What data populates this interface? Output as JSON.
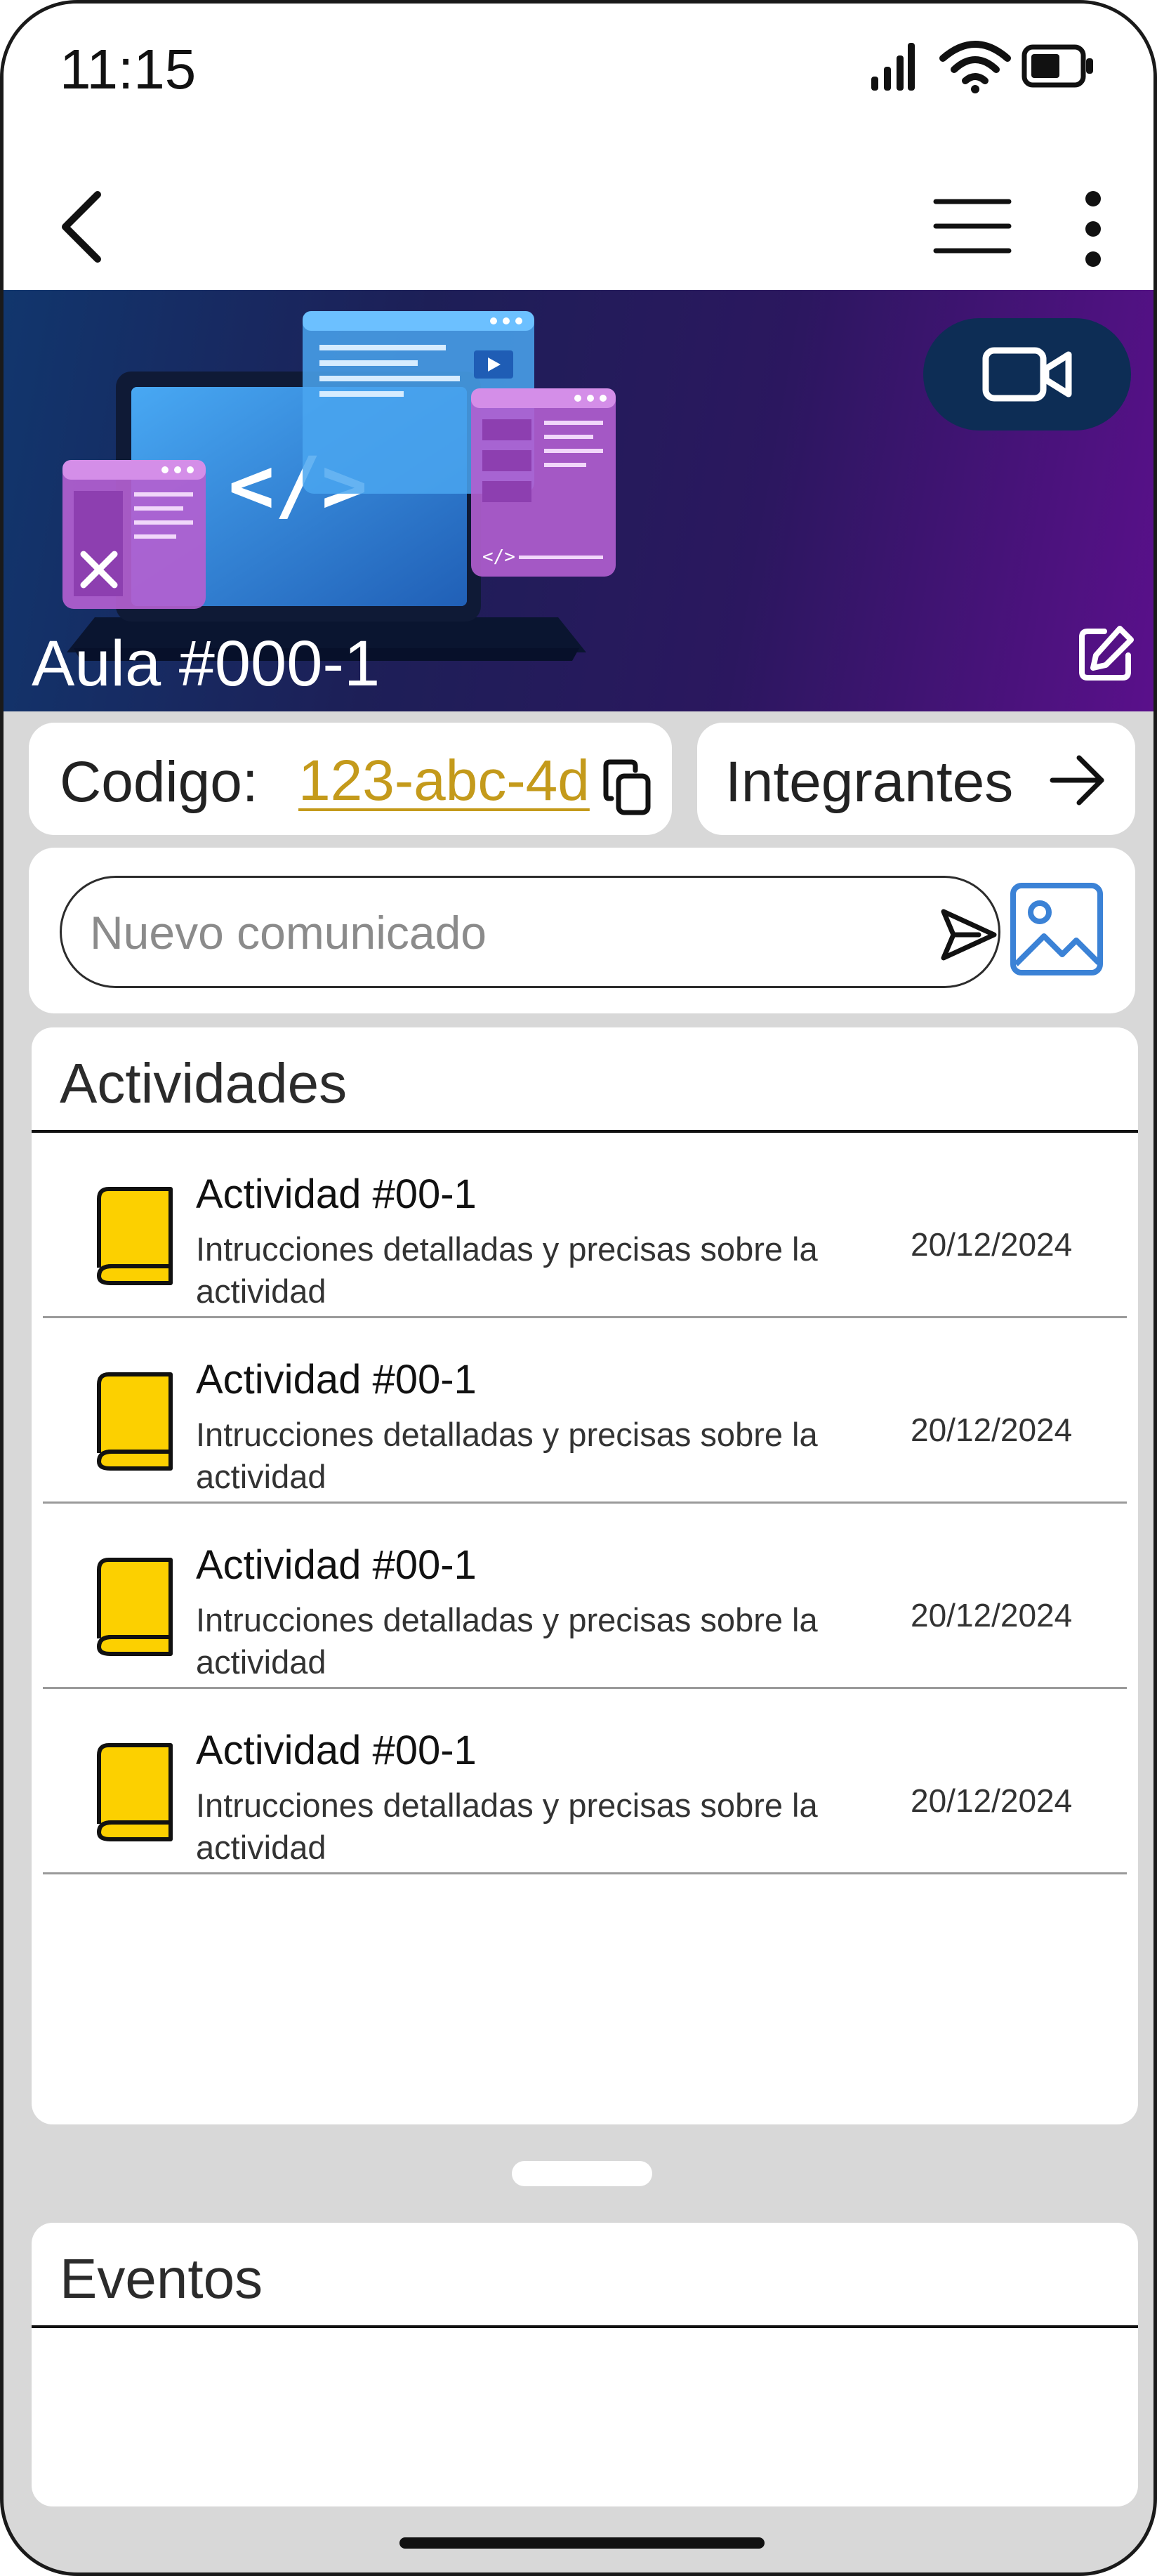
{
  "status_bar": {
    "time": "11:15"
  },
  "classroom": {
    "title": "Aula #000-1",
    "code_label": "Codigo:",
    "code_value": "123-abc-4d",
    "members_label": "Integrantes"
  },
  "announcement": {
    "placeholder": "Nuevo comunicado"
  },
  "activities": {
    "section_title": "Actividades",
    "items": [
      {
        "title": "Actividad #00-1",
        "description": "Intrucciones detalladas y precisas sobre la actividad",
        "date": "20/12/2024"
      },
      {
        "title": "Actividad #00-1",
        "description": "Intrucciones detalladas y precisas sobre la actividad",
        "date": "20/12/2024"
      },
      {
        "title": "Actividad #00-1",
        "description": "Intrucciones detalladas y precisas sobre la actividad",
        "date": "20/12/2024"
      },
      {
        "title": "Actividad #00-1",
        "description": "Intrucciones detalladas y precisas sobre la actividad",
        "date": "20/12/2024"
      }
    ]
  },
  "events": {
    "section_title": "Eventos"
  },
  "icons": {
    "status": [
      "signal-icon",
      "wifi-icon",
      "battery-icon"
    ],
    "app_bar": [
      "back-arrow-icon",
      "list-icon",
      "more-vertical-icon"
    ],
    "banner": [
      "video-camera-icon",
      "edit-icon"
    ],
    "code": "copy-icon",
    "members": "arrow-right-icon",
    "announcement": [
      "send-icon",
      "image-icon"
    ],
    "activity": "book-icon"
  },
  "colors": {
    "code_link": "#c49a1b",
    "book_fill": "#fcd000",
    "image_button": "#3b82d6",
    "video_button_bg": "#0d2d55",
    "banner_start": "#11366d",
    "banner_end": "#5a108b"
  }
}
